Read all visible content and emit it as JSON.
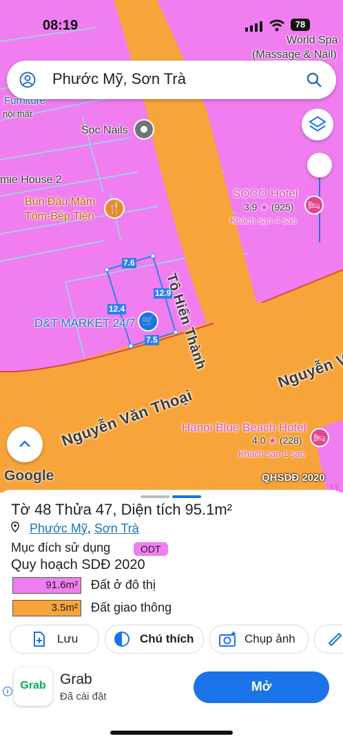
{
  "status_bar": {
    "time": "08:19",
    "battery": "78"
  },
  "search": {
    "query": "Phước Mỹ, Sơn Trà"
  },
  "map": {
    "places": {
      "world_spa": "World Spa",
      "world_spa_sub": "(Massage & Nail)",
      "furniture": "Furniture",
      "noi_that": "nội thất",
      "soc_nails": "Soc Nails",
      "mie_house": "mie House 2",
      "bun_dau_1": "Bún Đậu Mắm",
      "bun_dau_2": "Tôm-Bếp Tiên",
      "soco_hotel": "SOCO Hotel",
      "soco_rating": "3.9",
      "soco_reviews": "(925)",
      "soco_type": "Khách sạn 4 sao",
      "dt_market": "D&T MARKET 24/7",
      "hanoi_hotel": "Hanoi Blue Beach Hotel",
      "hanoi_rating": "4.0",
      "hanoi_reviews": "(228)",
      "hanoi_type": "Khách sạn 1 sao"
    },
    "roads": {
      "to_hien_thanh": "Tô Hiến Thành",
      "nguyen_van_thoai": "Nguyễn Văn Thoại",
      "nguyen_right": "Nguyễn V"
    },
    "dimensions": {
      "top": "7.6",
      "right": "12.9",
      "left": "12.4",
      "bottom": "7.5"
    },
    "google_logo": "Google",
    "overlay_label": "QHSDĐ 2020",
    "corner_badge": "13"
  },
  "sheet": {
    "title": "Tờ 48 Thửa 47, Diện tích 95.1m²",
    "ward_link": "Phước Mỹ",
    "district_link": "Sơn Trà",
    "purpose_label": "Mục đích sử dụng",
    "purpose_code": "ODT",
    "plan_label": "Quy hoạch SDĐ 2020",
    "legend": [
      {
        "area": "91.6m²",
        "label": "Đất ở đô thị",
        "color": "#f07ef0"
      },
      {
        "area": "3.5m²",
        "label": "Đất giao thông",
        "color": "#f7a43b"
      }
    ],
    "actions": [
      "Lưu",
      "Chú thích",
      "Chụp ảnh"
    ]
  },
  "ad": {
    "app_name": "Grab",
    "app_logo_text": "Grab",
    "status": "Đã cài đặt",
    "button": "Mở"
  },
  "colors": {
    "residential": "#f07ef0",
    "road": "#f7a43b",
    "accent_blue": "#1a73e8",
    "grab_green": "#00b14f"
  }
}
